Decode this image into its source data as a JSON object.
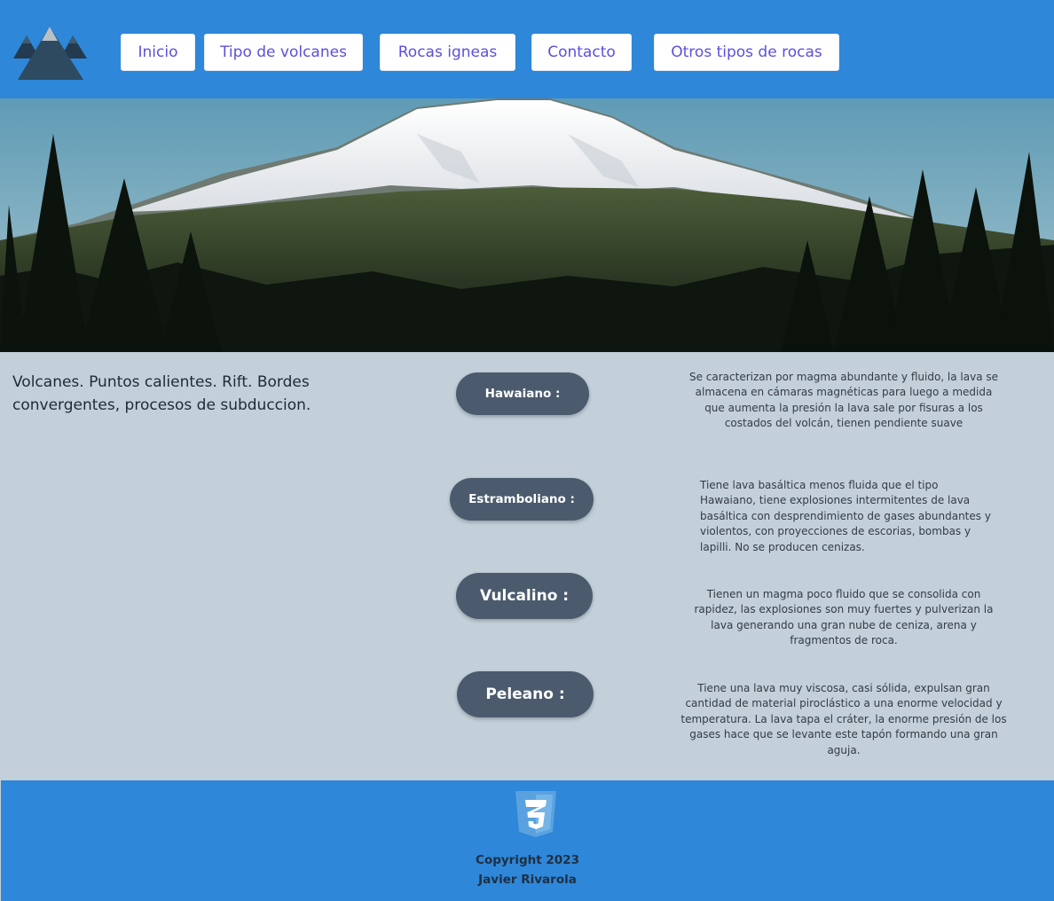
{
  "header": {
    "logo_icon": "mountain-logo-icon",
    "nav": [
      {
        "label": "Inicio"
      },
      {
        "label": "Tipo de volcanes"
      },
      {
        "label": "Rocas igneas"
      },
      {
        "label": "Contacto"
      },
      {
        "label": "Otros tipos de rocas"
      }
    ]
  },
  "hero": {
    "image": "snowy-volcano-forest-photo"
  },
  "intro": {
    "text": "Volcanes. Puntos calientes. Rift. Bordes convergentes, procesos de subduccion."
  },
  "types": [
    {
      "label": "Hawaiano :",
      "description": "Se caracterizan por magma abundante y fluido, la lava se almacena en cámaras magnéticas para luego a medida que aumenta la presión la lava sale por fisuras a los costados del volcán, tienen pendiente suave"
    },
    {
      "label": "Estramboliano :",
      "description": "Tiene lava basáltica menos fluida que el tipo Hawaiano, tiene explosiones intermitentes de lava basáltica con desprendimiento de gases abundantes y violentos, con proyecciones de escorias, bombas y lapilli. No se producen cenizas."
    },
    {
      "label": "Vulcalino :",
      "description": "Tienen un magma poco fluido que se consolida con rapidez, las explosiones son muy fuertes y pulverizan la lava generando una gran nube de ceniza, arena y fragmentos de roca."
    },
    {
      "label": "Peleano :",
      "description": "Tiene una lava muy viscosa, casi sólida, expulsan gran cantidad de material piroclástico a una enorme velocidad y temperatura. La lava tapa el cráter, la enorme presión de los gases hace que se levante este tapón formando una gran aguja."
    }
  ],
  "footer": {
    "logo_icon": "css3-icon",
    "copyright": "Copyright 2023",
    "author": "Javier Rivarola"
  },
  "colors": {
    "header_bg": "#2e87d8",
    "page_bg": "#c3d0da",
    "nav_text": "#5b4fe0",
    "pill_bg": "#4b5b6d"
  }
}
